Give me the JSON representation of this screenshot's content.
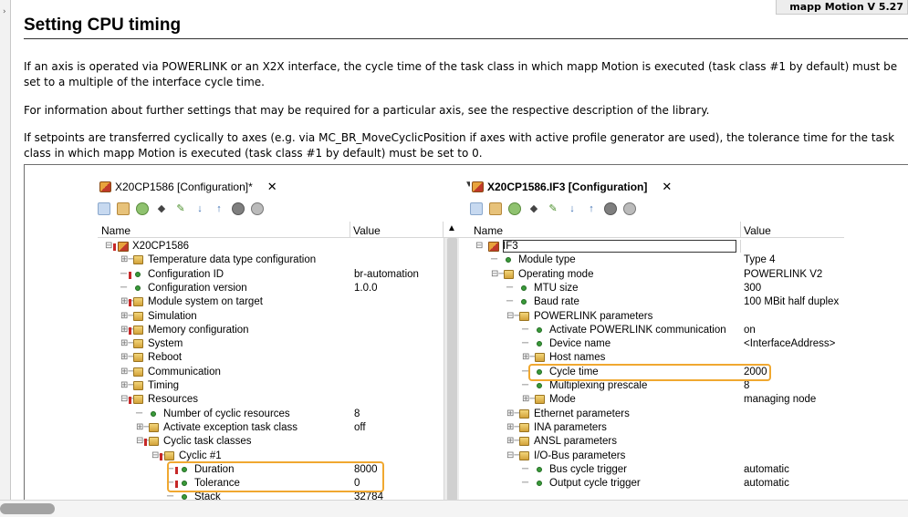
{
  "version_badge": "mapp Motion V 5.27",
  "page": {
    "title": "Setting CPU timing",
    "paragraphs": [
      "If an axis is operated via POWERLINK or an X2X interface, the cycle time of the task class in which mapp Motion is executed (task class #1 by default) must be set to a multiple of the interface cycle time.",
      "For information about further settings that may be required for a particular axis, see the respective description of the library.",
      "If setpoints are transferred cyclically to axes (e.g. via MC_BR_MoveCyclicPosition if axes with active profile generator are used), the tolerance time for the task class in which mapp Motion is executed (task class #1 by default) must be set to 0."
    ]
  },
  "left_panel": {
    "tab_label": "X20CP1586 [Configuration]*",
    "tab_close": "✕",
    "dropdown": "▼",
    "header": {
      "name": "Name",
      "value": "Value",
      "sort": "▲"
    },
    "rows": [
      {
        "tree": "⊟",
        "icon": "device",
        "label": "X20CP1586",
        "value": "",
        "indent": 0,
        "red": true
      },
      {
        "tree": "⊞─",
        "icon": "folder",
        "label": "Temperature data type configuration",
        "value": "",
        "indent": 1
      },
      {
        "tree": "─",
        "icon": "leaf",
        "label": "Configuration ID",
        "value": "br-automation",
        "indent": 1,
        "red": true
      },
      {
        "tree": "─",
        "icon": "leaf",
        "label": "Configuration version",
        "value": "1.0.0",
        "indent": 1
      },
      {
        "tree": "⊞─",
        "icon": "folder",
        "label": "Module system on target",
        "value": "",
        "indent": 1,
        "red": true
      },
      {
        "tree": "⊞─",
        "icon": "folder",
        "label": "Simulation",
        "value": "",
        "indent": 1
      },
      {
        "tree": "⊞─",
        "icon": "folder",
        "label": "Memory configuration",
        "value": "",
        "indent": 1,
        "red": true
      },
      {
        "tree": "⊞─",
        "icon": "folder",
        "label": "System",
        "value": "",
        "indent": 1
      },
      {
        "tree": "⊞─",
        "icon": "folder",
        "label": "Reboot",
        "value": "",
        "indent": 1
      },
      {
        "tree": "⊞─",
        "icon": "folder",
        "label": "Communication",
        "value": "",
        "indent": 1
      },
      {
        "tree": "⊞─",
        "icon": "folder",
        "label": "Timing",
        "value": "",
        "indent": 1
      },
      {
        "tree": "⊟─",
        "icon": "folder",
        "label": "Resources",
        "value": "",
        "indent": 1,
        "red": true
      },
      {
        "tree": "─",
        "icon": "leaf",
        "label": "Number of cyclic resources",
        "value": "8",
        "indent": 2
      },
      {
        "tree": "⊞─",
        "icon": "folder",
        "label": "Activate exception task class",
        "value": "off",
        "indent": 2
      },
      {
        "tree": "⊟─",
        "icon": "folder",
        "label": "Cyclic task classes",
        "value": "",
        "indent": 2,
        "red": true
      },
      {
        "tree": "⊟─",
        "icon": "folder",
        "label": "Cyclic #1",
        "value": "",
        "indent": 3,
        "red": true
      },
      {
        "tree": "─",
        "icon": "leaf",
        "label": "Duration",
        "value": "8000",
        "indent": 4,
        "red": true
      },
      {
        "tree": "─",
        "icon": "leaf",
        "label": "Tolerance",
        "value": "0",
        "indent": 4,
        "red": true
      },
      {
        "tree": "─",
        "icon": "leaf",
        "label": "Stack",
        "value": "32784",
        "indent": 4
      }
    ]
  },
  "right_panel": {
    "tab_label": "X20CP1586.IF3 [Configuration]",
    "tab_close": "✕",
    "header": {
      "name": "Name",
      "value": "Value"
    },
    "rows": [
      {
        "tree": "⊟",
        "icon": "device",
        "label": "IF3",
        "value": "",
        "indent": 0
      },
      {
        "tree": "─",
        "icon": "leaf",
        "label": "Module type",
        "value": "Type 4",
        "indent": 1,
        "blue": true
      },
      {
        "tree": "⊟─",
        "icon": "folder",
        "label": "Operating mode",
        "value": "POWERLINK V2",
        "indent": 1
      },
      {
        "tree": "─",
        "icon": "leaf",
        "label": "MTU size",
        "value": "300",
        "indent": 2
      },
      {
        "tree": "─",
        "icon": "leaf",
        "label": "Baud rate",
        "value": "100 MBit half duplex",
        "indent": 2,
        "blue": true
      },
      {
        "tree": "⊟─",
        "icon": "folder",
        "label": "POWERLINK parameters",
        "value": "",
        "indent": 2
      },
      {
        "tree": "─",
        "icon": "leaf",
        "label": "Activate POWERLINK communication",
        "value": "on",
        "indent": 3
      },
      {
        "tree": "─",
        "icon": "leaf",
        "label": "Device name",
        "value": "<InterfaceAddress>",
        "indent": 3,
        "blue": true
      },
      {
        "tree": "⊞─",
        "icon": "folder",
        "label": "Host names",
        "value": "",
        "indent": 3
      },
      {
        "tree": "─",
        "icon": "leaf",
        "label": "Cycle time",
        "value": "2000",
        "indent": 3
      },
      {
        "tree": "─",
        "icon": "leaf",
        "label": "Multiplexing prescale",
        "value": "8",
        "indent": 3
      },
      {
        "tree": "⊞─",
        "icon": "folder",
        "label": "Mode",
        "value": "managing node",
        "indent": 3
      },
      {
        "tree": "⊞─",
        "icon": "folder",
        "label": "Ethernet parameters",
        "value": "",
        "indent": 2
      },
      {
        "tree": "⊞─",
        "icon": "folder",
        "label": "INA parameters",
        "value": "",
        "indent": 2
      },
      {
        "tree": "⊞─",
        "icon": "folder",
        "label": "ANSL parameters",
        "value": "",
        "indent": 2
      },
      {
        "tree": "⊟─",
        "icon": "folder",
        "label": "I/O-Bus parameters",
        "value": "",
        "indent": 2
      },
      {
        "tree": "─",
        "icon": "leaf",
        "label": "Bus cycle trigger",
        "value": "automatic",
        "indent": 3
      },
      {
        "tree": "─",
        "icon": "leaf",
        "label": "Output cycle trigger",
        "value": "automatic",
        "indent": 3
      }
    ]
  },
  "colors": {
    "highlight": "#f0a830",
    "marker_red": "#c62828"
  }
}
